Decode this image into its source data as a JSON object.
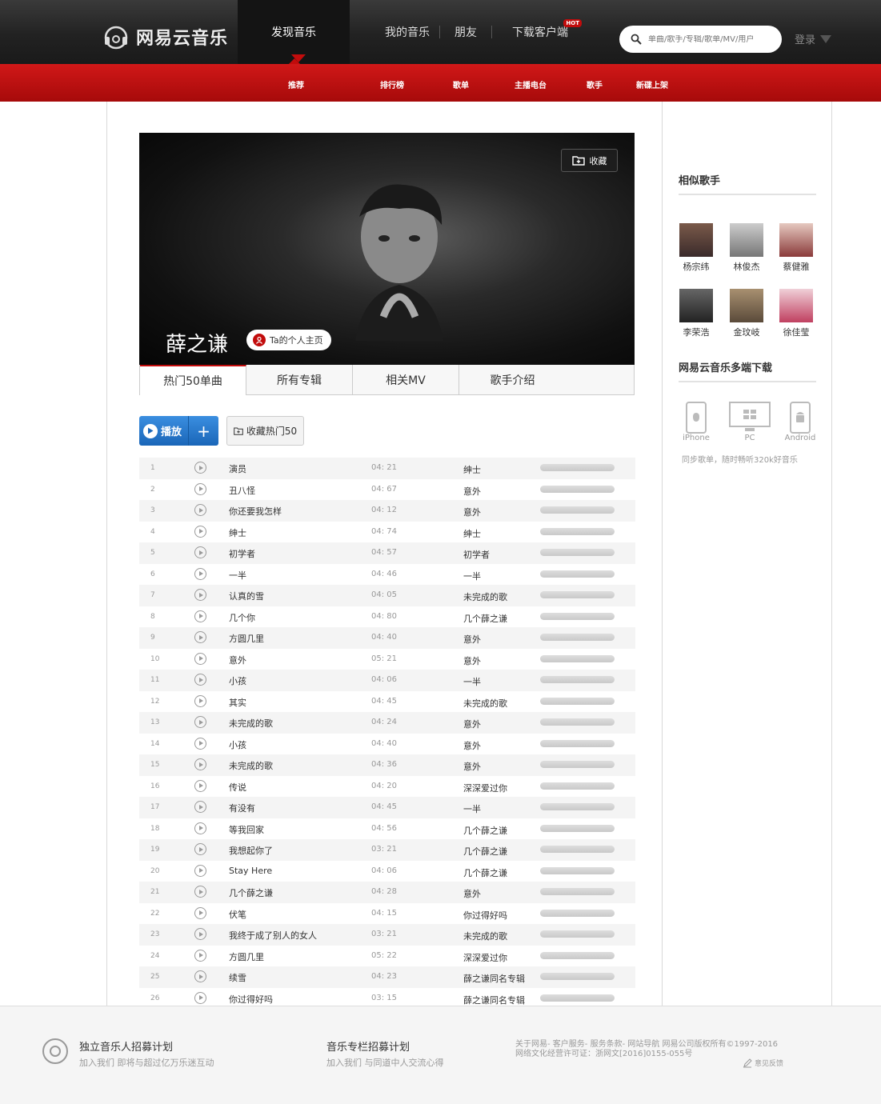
{
  "header": {
    "logo_text": "网易云音乐",
    "nav": [
      "发现音乐",
      "我的音乐",
      "朋友",
      "下载客户端"
    ],
    "hot_badge": "HOT",
    "search_placeholder": "单曲/歌手/专辑/歌单/MV/用户",
    "login": "登录"
  },
  "subnav": [
    "推荐",
    "排行榜",
    "歌单",
    "主播电台",
    "歌手",
    "新碟上架"
  ],
  "banner": {
    "collect_label": "收藏",
    "singer_name": "薛之谦",
    "homepage_label": "Ta的个人主页"
  },
  "tabs": [
    "热门50单曲",
    "所有专辑",
    "相关MV",
    "歌手介绍"
  ],
  "actions": {
    "play_label": "播放",
    "add_label": "+",
    "collect_hot_label": "收藏热门50"
  },
  "songs": [
    {
      "num": "1",
      "title": "演员",
      "duration": "04: 21",
      "album": "绅士"
    },
    {
      "num": "2",
      "title": "丑八怪",
      "duration": "04: 67",
      "album": "意外"
    },
    {
      "num": "3",
      "title": "你还要我怎样",
      "duration": "04: 12",
      "album": "意外"
    },
    {
      "num": "4",
      "title": "绅士",
      "duration": "04: 74",
      "album": "绅士"
    },
    {
      "num": "5",
      "title": "初学者",
      "duration": "04: 57",
      "album": "初学者"
    },
    {
      "num": "6",
      "title": "一半",
      "duration": "04: 46",
      "album": "一半"
    },
    {
      "num": "7",
      "title": "认真的雪",
      "duration": "04: 05",
      "album": "未完成的歌"
    },
    {
      "num": "8",
      "title": "几个你",
      "duration": "04: 80",
      "album": "几个薛之谦"
    },
    {
      "num": "9",
      "title": "方圆几里",
      "duration": "04: 40",
      "album": "意外"
    },
    {
      "num": "10",
      "title": "意外",
      "duration": "05: 21",
      "album": "意外"
    },
    {
      "num": "11",
      "title": "小孩",
      "duration": "04: 06",
      "album": "一半"
    },
    {
      "num": "12",
      "title": "其实",
      "duration": "04: 45",
      "album": "未完成的歌"
    },
    {
      "num": "13",
      "title": "未完成的歌",
      "duration": "04: 24",
      "album": "意外"
    },
    {
      "num": "14",
      "title": "小孩",
      "duration": "04: 40",
      "album": "意外"
    },
    {
      "num": "15",
      "title": "未完成的歌",
      "duration": "04: 36",
      "album": "意外"
    },
    {
      "num": "16",
      "title": "传说",
      "duration": "04: 20",
      "album": "深深爱过你"
    },
    {
      "num": "17",
      "title": "有没有",
      "duration": "04: 45",
      "album": "一半"
    },
    {
      "num": "18",
      "title": "等我回家",
      "duration": "04: 56",
      "album": "几个薛之谦"
    },
    {
      "num": "19",
      "title": "我想起你了",
      "duration": "03: 21",
      "album": "几个薛之谦"
    },
    {
      "num": "20",
      "title": "Stay Here",
      "duration": "04: 06",
      "album": "几个薛之谦"
    },
    {
      "num": "21",
      "title": "几个薛之谦",
      "duration": "04: 28",
      "album": "意外"
    },
    {
      "num": "22",
      "title": "伏笔",
      "duration": "04: 15",
      "album": "你过得好吗"
    },
    {
      "num": "23",
      "title": "我终于成了别人的女人",
      "duration": "03: 21",
      "album": "未完成的歌"
    },
    {
      "num": "24",
      "title": "方圆几里",
      "duration": "05: 22",
      "album": "深深爱过你"
    },
    {
      "num": "25",
      "title": "续雪",
      "duration": "04: 23",
      "album": "薛之谦同名专辑"
    },
    {
      "num": "26",
      "title": "你过得好吗",
      "duration": "03: 15",
      "album": "薛之谦同名专辑"
    }
  ],
  "sidebar": {
    "similar_title": "相似歌手",
    "similar": [
      "杨宗纬",
      "林俊杰",
      "蔡健雅",
      "李荣浩",
      "金玟岐",
      "徐佳莹"
    ],
    "download_title": "网易云音乐多端下载",
    "devices": [
      "iPhone",
      "PC",
      "Android"
    ],
    "download_desc": "同步歌单，随时畅听320k好音乐"
  },
  "footer": {
    "col1_title": "独立音乐人招募计划",
    "col1_sub": "加入我们 即将与超过亿万乐迷互动",
    "col2_title": "音乐专栏招募计划",
    "col2_sub": "加入我们 与同道中人交流心得",
    "links_line1": "关于网易- 客户服务- 服务条款- 网站导航 网易公司版权所有©1997-2016",
    "links_line2": "网络文化经营许可证：浙网文[2016]0155-055号",
    "feedback": "意见反馈"
  }
}
